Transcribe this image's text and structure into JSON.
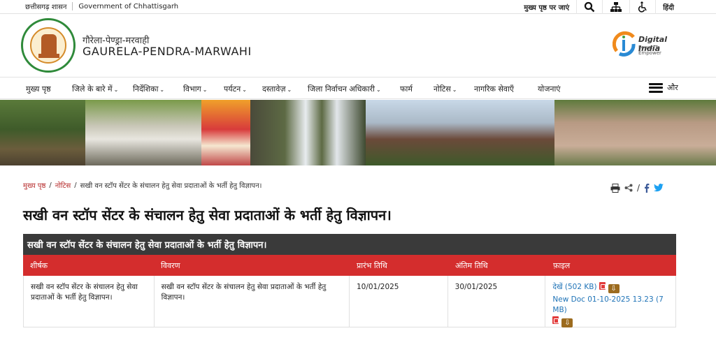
{
  "topbar": {
    "govt_hi": "छत्तीसगढ़ शासन",
    "govt_en": "Government of Chhattisgarh",
    "main_content": "मुख्य पृष्ठ पर जाएं",
    "language": "हिंदी"
  },
  "header": {
    "name_hi": "गौरेला-पेण्ड्रा-मरवाही",
    "name_en": "GAURELA-PENDRA-MARWAHI",
    "digital_india": "Digital India",
    "digital_india_tag": "Power To Empower"
  },
  "nav": {
    "items": [
      {
        "label": "मुख्य पृष्ठ",
        "dropdown": false
      },
      {
        "label": "जिले के बारे में",
        "dropdown": true
      },
      {
        "label": "निर्देशिका",
        "dropdown": true
      },
      {
        "label": "विभाग",
        "dropdown": true
      },
      {
        "label": "पर्यटन",
        "dropdown": true
      },
      {
        "label": "दस्तावेज़",
        "dropdown": true
      },
      {
        "label": "जिला निर्वाचन अधिकारी",
        "dropdown": true
      },
      {
        "label": "फार्म",
        "dropdown": false
      },
      {
        "label": "नोटिस",
        "dropdown": true
      },
      {
        "label": "नागरिक सेवाएँ",
        "dropdown": false
      },
      {
        "label": "योजनाएं",
        "dropdown": false
      }
    ],
    "more": "और"
  },
  "breadcrumb": {
    "home": "मुख्य पृष्ठ",
    "section": "नोटिस",
    "current": "सखी वन स्टॉप सेंटर के संचालन हेतु सेवा प्रदाताओं के भर्ती हेतु विज्ञापन।"
  },
  "page_title": "सखी वन स्टॉप सेंटर के संचालन हेतु सेवा प्रदाताओं के भर्ती हेतु विज्ञापन।",
  "table": {
    "caption": "सखी वन स्टॉप सेंटर के संचालन हेतु सेवा प्रदाताओं के भर्ती हेतु विज्ञापन।",
    "headers": [
      "शीर्षक",
      "विवरण",
      "प्रारंभ तिथि",
      "अंतिम तिथि",
      "फ़ाइल"
    ],
    "rows": [
      {
        "title": "सखी वन स्टॉप सेंटर के संचालन हेतु सेवा प्रदाताओं के भर्ती हेतु विज्ञापन।",
        "description": "सखी वन स्टॉप सेंटर के संचालन हेतु सेवा प्रदाताओं के भर्ती हेतु विज्ञापन।",
        "start_date": "10/01/2025",
        "end_date": "30/01/2025",
        "files": [
          {
            "label": "देखें (502 KB)"
          },
          {
            "label": "New Doc 01-10-2025 13.23 (7 MB)"
          }
        ]
      }
    ]
  },
  "colors": {
    "accent_red": "#d42d2d",
    "caption_dark": "#3a3a3a",
    "link_blue": "#1f73b7",
    "breadcrumb_red": "#b62a2a"
  }
}
